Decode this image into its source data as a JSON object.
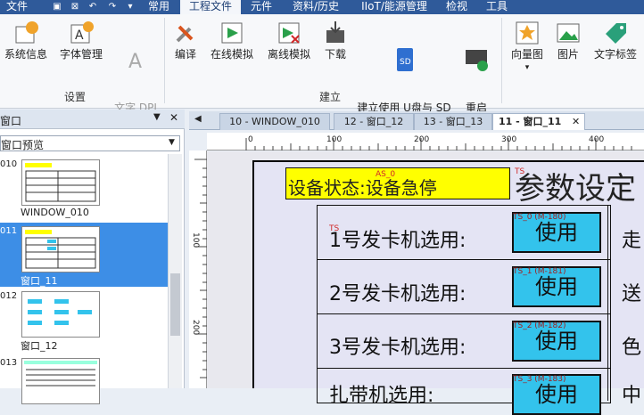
{
  "menubar": {
    "file": "文件",
    "tabs": [
      "常用",
      "工程文件",
      "元件",
      "资料/历史",
      "IIoT/能源管理",
      "检视",
      "工具"
    ]
  },
  "ribbon": {
    "buttons": [
      "系统信息",
      "字体管理",
      "文字 DPI\n设置",
      "编译",
      "在线模拟",
      "离线模拟",
      "下载",
      "建立使用 U盘与 SD\n卡所需的下载资料",
      "重启\nHMI",
      "向量图",
      "图片",
      "文字标签"
    ],
    "groups": [
      "设置",
      "建立"
    ]
  },
  "left_panel": {
    "title": "窗口",
    "select_value": "窗口预览",
    "items": [
      {
        "num": "010",
        "label": "WINDOW_010",
        "selected": false
      },
      {
        "num": "011",
        "label": "窗口_11",
        "selected": true
      },
      {
        "num": "012",
        "label": "窗口_12",
        "selected": false
      },
      {
        "num": "013",
        "label": "",
        "selected": false
      }
    ]
  },
  "tabs": [
    "10 - WINDOW_010",
    "12 - 窗口_12",
    "13 - 窗口_13",
    "11 - 窗口_11"
  ],
  "active_tab": "11 - 窗口_11",
  "ruler": {
    "top": [
      "0",
      "100",
      "200",
      "300",
      "400"
    ],
    "left": [
      "100",
      "200"
    ]
  },
  "screen": {
    "status_tag": "AS_0",
    "status_text": "设备状态:设备急停",
    "title_tag": "TS",
    "title": "参数设定",
    "rows": [
      {
        "label": "1号发卡机选用:",
        "tag": "TS_0 (M-180)",
        "button": "使用",
        "right": "走"
      },
      {
        "label": "2号发卡机选用:",
        "tag": "TS_1 (M-181)",
        "button": "使用",
        "right": "送"
      },
      {
        "label": "3号发卡机选用:",
        "tag": "TS_2 (M-182)",
        "button": "使用",
        "right": "色"
      },
      {
        "label": "扎带机选用:",
        "tag": "TS_3 (M-183)",
        "button": "使用",
        "right": "中"
      }
    ]
  },
  "colors": {
    "menubar": "#2f5a9a",
    "selection": "#3d8ee6",
    "button": "#33c3ec",
    "status_bg": "#ffff00"
  }
}
